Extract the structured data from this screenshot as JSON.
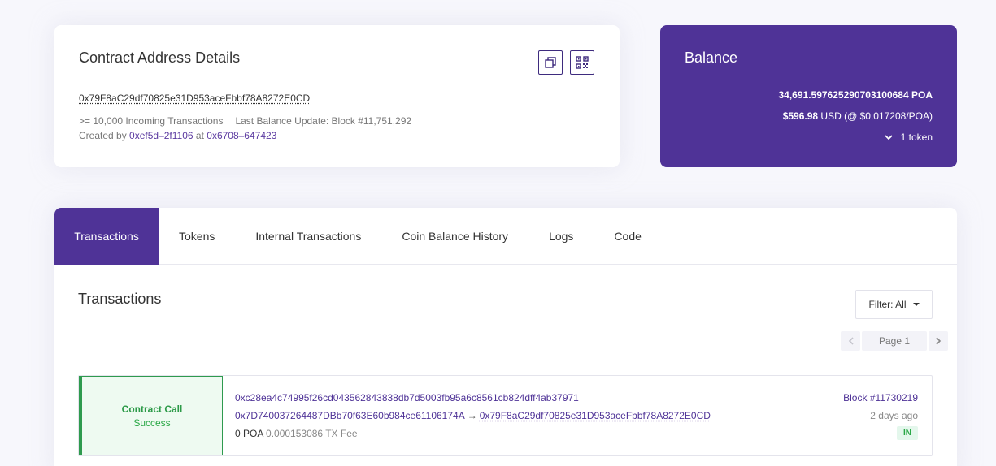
{
  "details": {
    "title": "Contract Address Details",
    "address": "0x79F8aC29df70825e31D953aceFbbf78A8272E0CD",
    "incoming": ">= 10,000 Incoming Transactions",
    "last_update": "Last Balance Update: Block #11,751,292",
    "created_by_label": "Created by",
    "creator": "0xef5d–2f1106",
    "at_label": "at",
    "creation_tx": "0x6708–647423",
    "copy_icon": "copy-icon",
    "qr_icon": "qr-code-icon"
  },
  "balance": {
    "title": "Balance",
    "poa": "34,691.597625290703100684 POA",
    "usd_value": "$596.98",
    "usd_rest": "USD (@ $0.017208/POA)",
    "tokens": "1 token"
  },
  "tabs": [
    {
      "label": "Transactions"
    },
    {
      "label": "Tokens"
    },
    {
      "label": "Internal Transactions"
    },
    {
      "label": "Coin Balance History"
    },
    {
      "label": "Logs"
    },
    {
      "label": "Code"
    }
  ],
  "transactions": {
    "title": "Transactions",
    "filter_label": "Filter: All",
    "page_label": "Page 1",
    "items": [
      {
        "type": "Contract Call",
        "status": "Success",
        "hash": "0xc28ea4c74995f26cd043562843838db7d5003fb95a6c8561cb824dff4ab37971",
        "from": "0x7D740037264487DBb70f63E60b984ce61106174A",
        "arrow": "→",
        "to": "0x79F8aC29df70825e31D953aceFbbf78A8272E0CD",
        "value": "0 POA",
        "fee": "0.000153086 TX Fee",
        "block": "Block #11730219",
        "age": "2 days ago",
        "direction": "IN"
      }
    ]
  },
  "colors": {
    "brand": "#4f3397",
    "success": "#28a745",
    "background": "#f7f7fc"
  }
}
